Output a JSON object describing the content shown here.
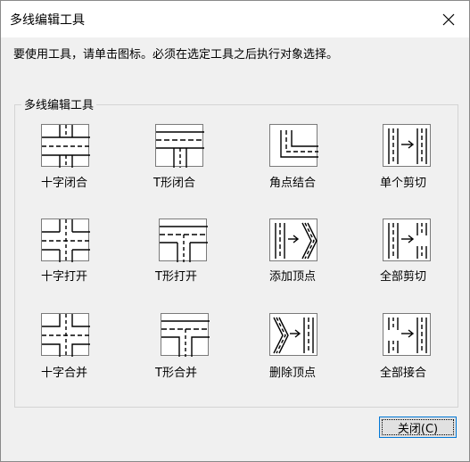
{
  "window": {
    "title": "多线编辑工具",
    "close_icon": "close-icon"
  },
  "instruction": "要使用工具，请单击图标。必须在选定工具之后执行对象选择。",
  "group": {
    "label": "多线编辑工具"
  },
  "tools": [
    {
      "label": "十字闭合",
      "icon": "cross-closed-icon"
    },
    {
      "label": "T形闭合",
      "icon": "tee-closed-icon"
    },
    {
      "label": "角点结合",
      "icon": "corner-joint-icon"
    },
    {
      "label": "单个剪切",
      "icon": "cut-single-icon"
    },
    {
      "label": "十字打开",
      "icon": "cross-open-icon"
    },
    {
      "label": "T形打开",
      "icon": "tee-open-icon"
    },
    {
      "label": "添加顶点",
      "icon": "add-vertex-icon"
    },
    {
      "label": "全部剪切",
      "icon": "cut-all-icon"
    },
    {
      "label": "十字合并",
      "icon": "cross-merged-icon"
    },
    {
      "label": "T形合并",
      "icon": "tee-merged-icon"
    },
    {
      "label": "删除顶点",
      "icon": "delete-vertex-icon"
    },
    {
      "label": "全部接合",
      "icon": "weld-all-icon"
    }
  ],
  "buttons": {
    "close_label": "关闭(C)"
  },
  "colors": {
    "focus_border": "#0078d7",
    "dialog_bg": "#f0f0f0"
  }
}
